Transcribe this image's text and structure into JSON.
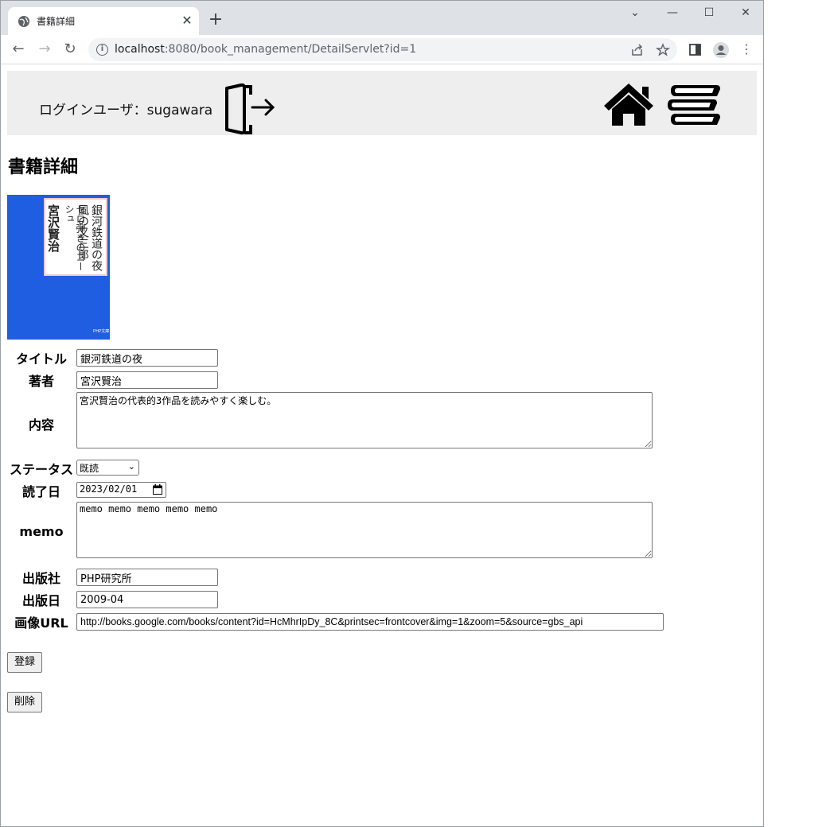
{
  "browser": {
    "tab_title": "書籍詳細",
    "url_host": "localhost",
    "url_path": ":8080/book_management/DetailServlet?id=1"
  },
  "header": {
    "login_user": "ログインユーザ：sugawara"
  },
  "page": {
    "title": "書籍詳細"
  },
  "cover": {
    "title_col1": "銀河鉄道の夜",
    "title_col2": "風の又三郎",
    "title_col3": "セロ弾きのゴーシュ",
    "author": "宮沢賢治",
    "publisher_mark": "PHP文庫"
  },
  "form": {
    "title_label": "タイトル",
    "title_value": "銀河鉄道の夜",
    "author_label": "著者",
    "author_value": "宮沢賢治",
    "content_label": "内容",
    "content_value": "宮沢賢治の代表的3作品を読みやすく楽しむ。",
    "status_label": "ステータス",
    "status_value": "既読",
    "read_date_label": "読了日",
    "read_date_value": "2023/02/01",
    "memo_label": "memo",
    "memo_value": "memo memo memo memo memo",
    "publisher_label": "出版社",
    "publisher_value": "PHP研究所",
    "pub_date_label": "出版日",
    "pub_date_value": "2009-04",
    "image_url_label": "画像URL",
    "image_url_value": "http://books.google.com/books/content?id=HcMhrIpDy_8C&printsec=frontcover&img=1&zoom=5&source=gbs_api",
    "register_button": "登録",
    "delete_button": "削除"
  }
}
